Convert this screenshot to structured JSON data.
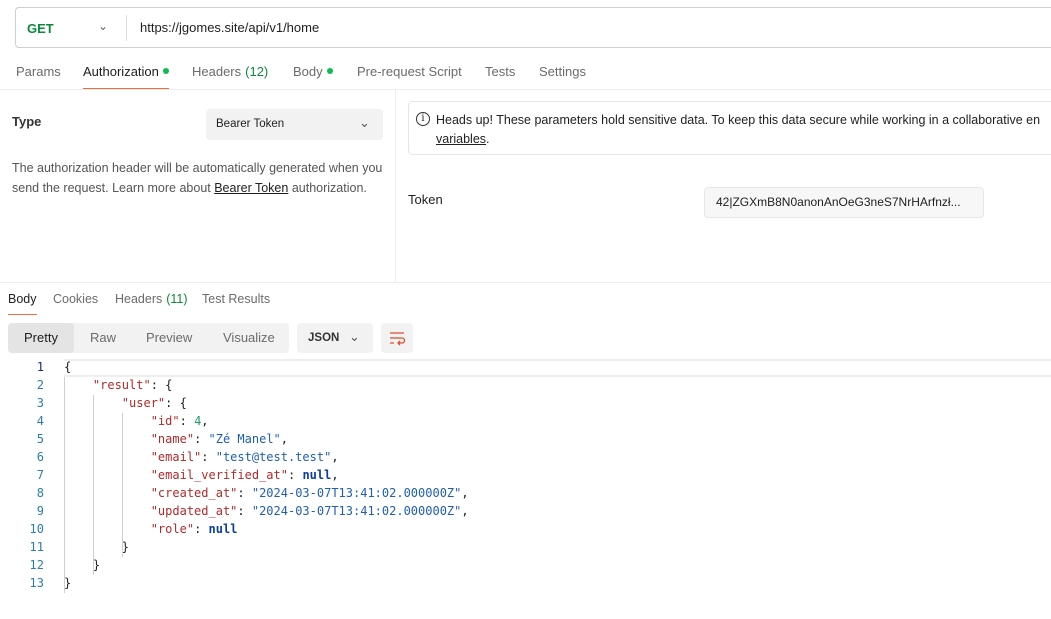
{
  "request": {
    "method": "GET",
    "url": "https://jgomes.site/api/v1/home"
  },
  "request_tabs": [
    {
      "label": "Params"
    },
    {
      "label": "Authorization",
      "dot": true,
      "active": true
    },
    {
      "label": "Headers",
      "count": "(12)"
    },
    {
      "label": "Body",
      "dot": true
    },
    {
      "label": "Pre-request Script"
    },
    {
      "label": "Tests"
    },
    {
      "label": "Settings"
    }
  ],
  "auth": {
    "type_label": "Type",
    "type_value": "Bearer Token",
    "desc_pre": "The authorization header will be automatically generated when you send the request. Learn more about ",
    "desc_link": "Bearer Token",
    "desc_post": " authorization.",
    "alert_text": "Heads up! These parameters hold sensitive data. To keep this data secure while working in a collaborative en",
    "alert_link": "variables",
    "alert_post": ".",
    "token_label": "Token",
    "token_value": "42|ZGXmB8N0anonAnOeG3neS7NrHArfnzł..."
  },
  "response_tabs": [
    {
      "label": "Body",
      "active": true
    },
    {
      "label": "Cookies"
    },
    {
      "label": "Headers",
      "count": "(11)"
    },
    {
      "label": "Test Results"
    }
  ],
  "view_modes": [
    "Pretty",
    "Raw",
    "Preview",
    "Visualize"
  ],
  "active_view": "Pretty",
  "format": "JSON",
  "colors": {
    "accent": "#f26b3a",
    "green": "#0b8a3a",
    "key": "#b22a2a",
    "string": "#1f5fb0",
    "number": "#1a9c6b",
    "literal": "#0d3fa0"
  },
  "code_lines": [
    [
      [
        "p",
        "{"
      ]
    ],
    [
      [
        "p",
        "    "
      ],
      [
        "k",
        "\"result\""
      ],
      [
        "p",
        ": {"
      ]
    ],
    [
      [
        "p",
        "        "
      ],
      [
        "k",
        "\"user\""
      ],
      [
        "p",
        ": {"
      ]
    ],
    [
      [
        "p",
        "            "
      ],
      [
        "k",
        "\"id\""
      ],
      [
        "p",
        ": "
      ],
      [
        "n",
        "4"
      ],
      [
        "p",
        ","
      ]
    ],
    [
      [
        "p",
        "            "
      ],
      [
        "k",
        "\"name\""
      ],
      [
        "p",
        ": "
      ],
      [
        "s",
        "\"Zé Manel\""
      ],
      [
        "p",
        ","
      ]
    ],
    [
      [
        "p",
        "            "
      ],
      [
        "k",
        "\"email\""
      ],
      [
        "p",
        ": "
      ],
      [
        "s",
        "\"test@test.test\""
      ],
      [
        "p",
        ","
      ]
    ],
    [
      [
        "p",
        "            "
      ],
      [
        "k",
        "\"email_verified_at\""
      ],
      [
        "p",
        ": "
      ],
      [
        "b",
        "null"
      ],
      [
        "p",
        ","
      ]
    ],
    [
      [
        "p",
        "            "
      ],
      [
        "k",
        "\"created_at\""
      ],
      [
        "p",
        ": "
      ],
      [
        "s",
        "\"2024-03-07T13:41:02.000000Z\""
      ],
      [
        "p",
        ","
      ]
    ],
    [
      [
        "p",
        "            "
      ],
      [
        "k",
        "\"updated_at\""
      ],
      [
        "p",
        ": "
      ],
      [
        "s",
        "\"2024-03-07T13:41:02.000000Z\""
      ],
      [
        "p",
        ","
      ]
    ],
    [
      [
        "p",
        "            "
      ],
      [
        "k",
        "\"role\""
      ],
      [
        "p",
        ": "
      ],
      [
        "b",
        "null"
      ]
    ],
    [
      [
        "p",
        "        }"
      ]
    ],
    [
      [
        "p",
        "    }"
      ]
    ],
    [
      [
        "p",
        "}"
      ]
    ]
  ]
}
